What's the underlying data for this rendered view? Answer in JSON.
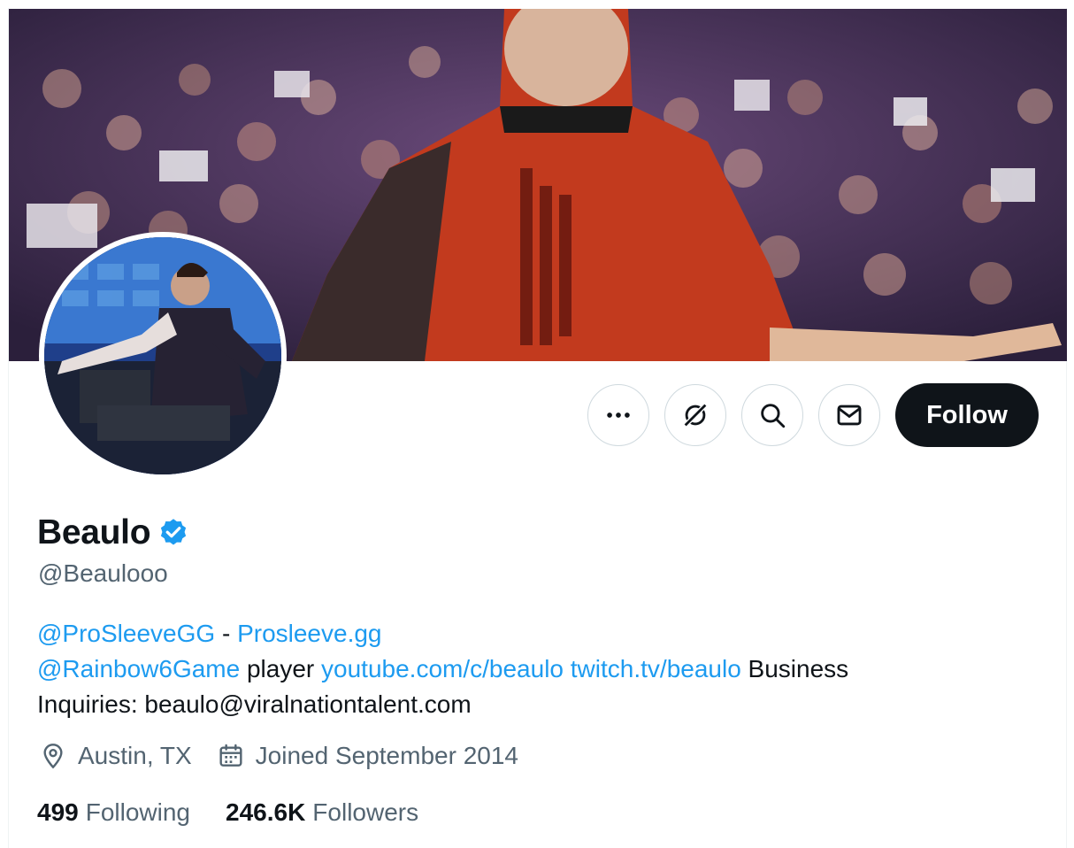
{
  "profile": {
    "display_name": "Beaulo",
    "handle": "@Beaulooo",
    "verified_icon": "verified-badge-icon",
    "bio": {
      "line1_mention": "@ProSleeveGG",
      "line1_sep": " - ",
      "line1_link": "Prosleeve.gg",
      "line2_mention": "@Rainbow6Game",
      "line2_text": " player ",
      "line2_link1": "youtube.com/c/beaulo",
      "line2_space": " ",
      "line2_link2": "twitch.tv/beaulo",
      "line2_text2": " Business",
      "line3_text": "Inquiries: beaulo@viralnationtalent.com"
    },
    "location": "Austin, TX",
    "joined": "Joined September 2014",
    "following_count": "499",
    "following_label": "Following",
    "followers_count": "246.6K",
    "followers_label": "Followers"
  },
  "actions": {
    "more_icon": "more-icon",
    "grok_icon": "grok-icon",
    "search_icon": "search-icon",
    "message_icon": "message-icon",
    "follow_label": "Follow"
  },
  "colors": {
    "link": "#1d9bf0",
    "text": "#0f1419",
    "secondary": "#536471",
    "follow_bg": "#0f1419"
  }
}
